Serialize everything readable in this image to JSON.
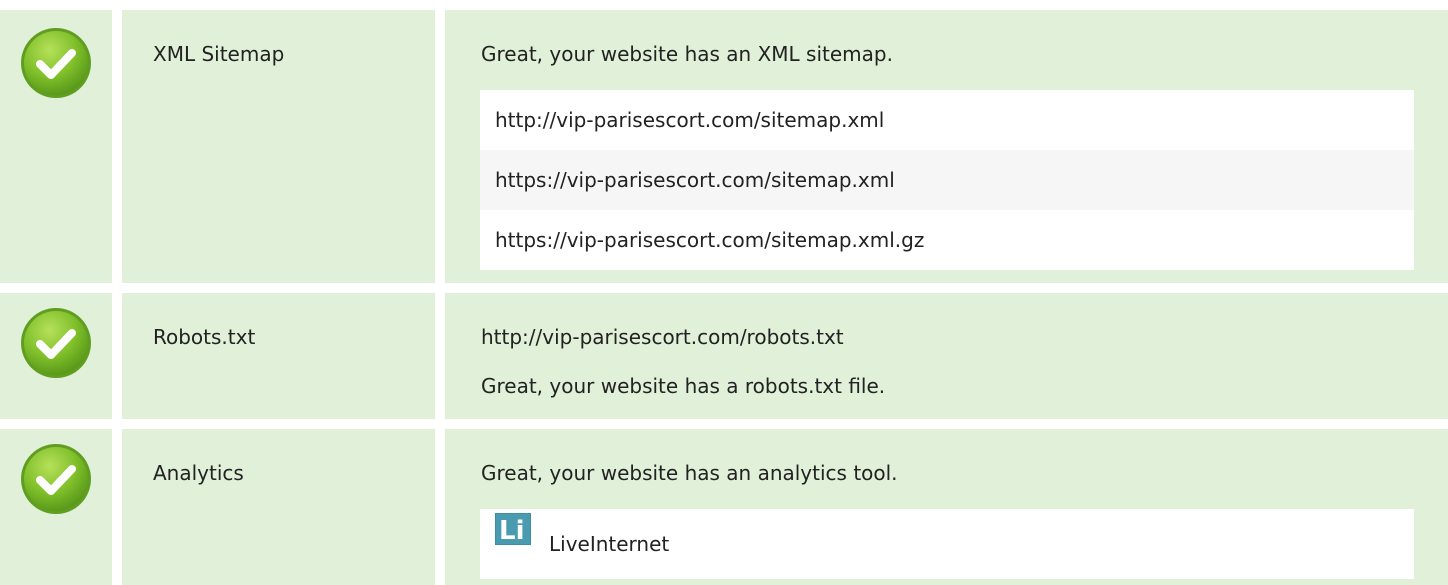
{
  "rows": [
    {
      "label": "XML Sitemap",
      "message": "Great, your website has an XML sitemap.",
      "urls": [
        "http://vip-parisescort.com/sitemap.xml",
        "https://vip-parisescort.com/sitemap.xml",
        "https://vip-parisescort.com/sitemap.xml.gz"
      ]
    },
    {
      "label": "Robots.txt",
      "url": "http://vip-parisescort.com/robots.txt",
      "message": "Great, your website has a robots.txt file."
    },
    {
      "label": "Analytics",
      "message": "Great, your website has an analytics tool.",
      "tools": [
        {
          "logo_text": "Li",
          "name": "LiveInternet"
        }
      ]
    }
  ],
  "colors": {
    "row_bg": "#e1f0d8",
    "check_green": "#8cc63f",
    "logo_bg": "#3f8fa3"
  },
  "icons": {
    "status": "check-circle-icon"
  }
}
